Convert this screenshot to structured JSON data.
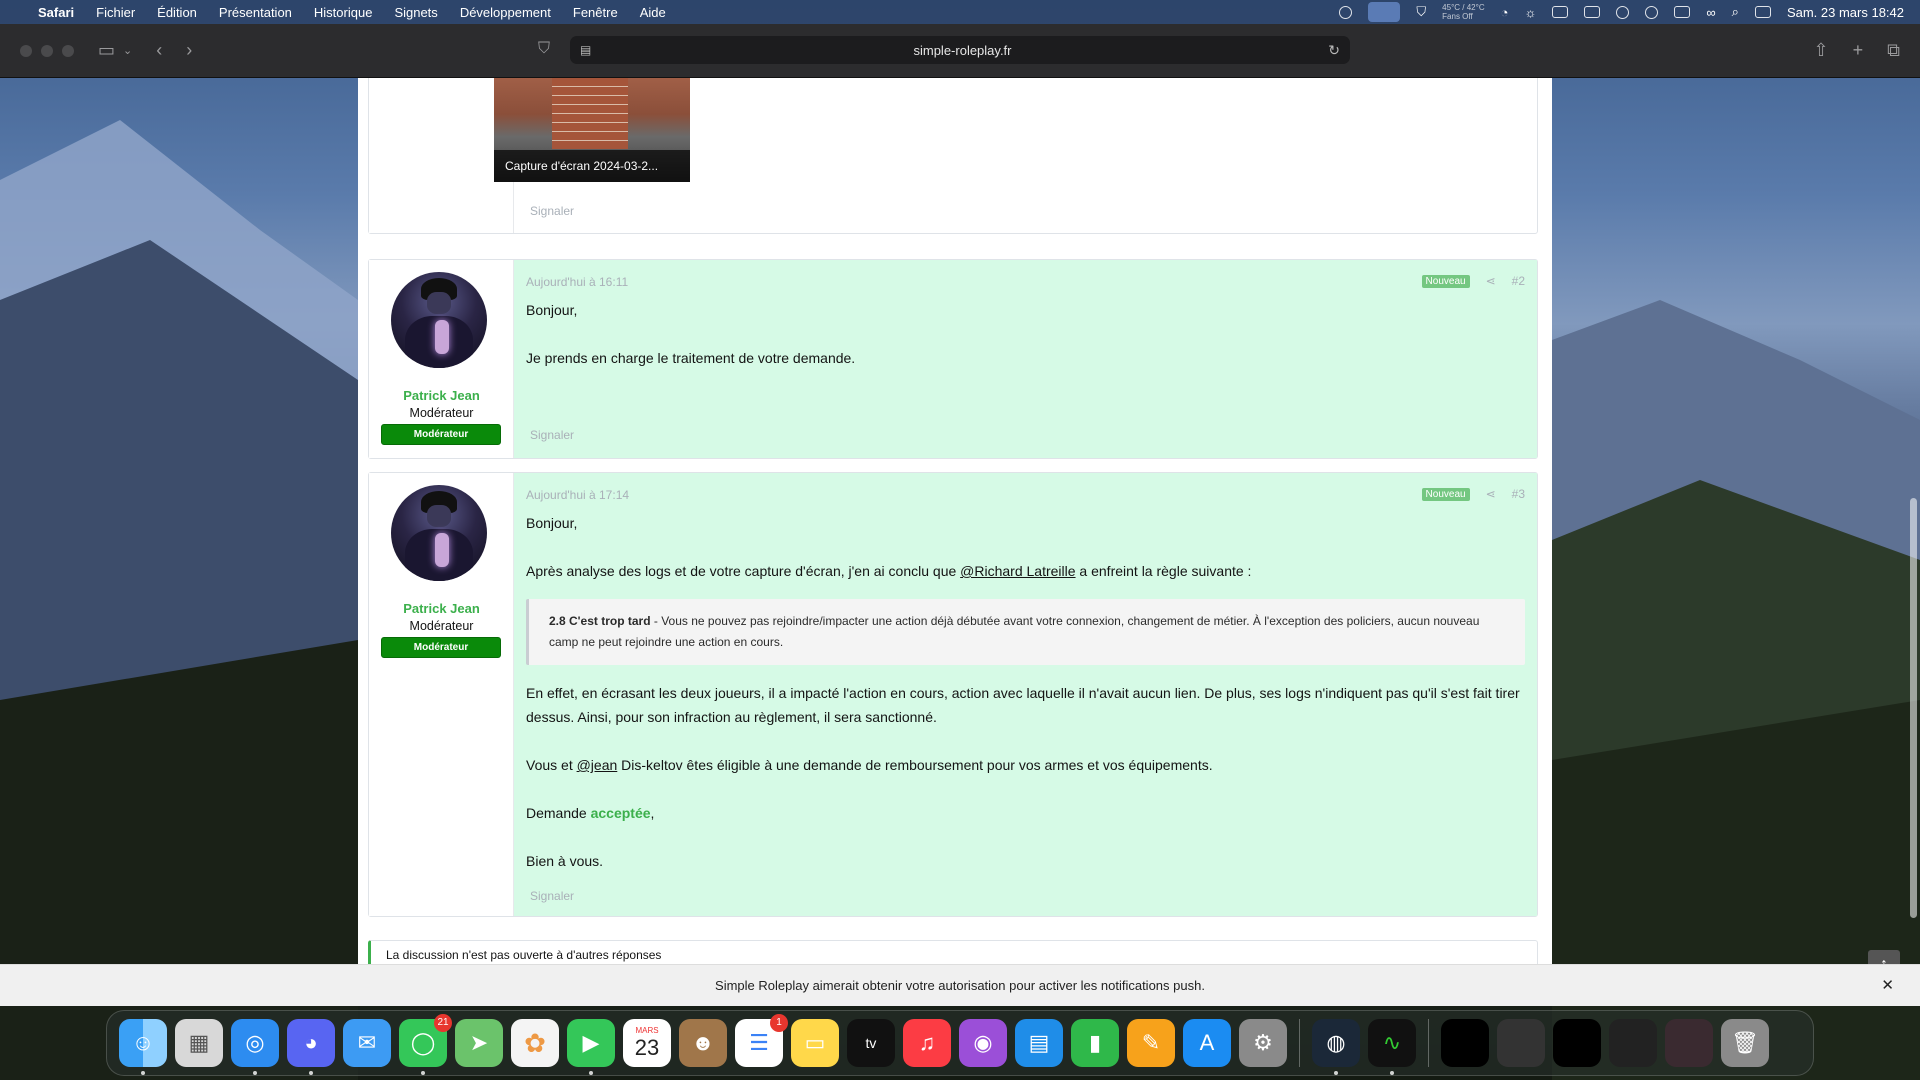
{
  "menubar": {
    "app": "Safari",
    "items": [
      "Fichier",
      "Édition",
      "Présentation",
      "Historique",
      "Signets",
      "Développement",
      "Fenêtre",
      "Aide"
    ],
    "fans": "45°C / 42°C",
    "fans_status": "Fans Off",
    "datetime": "Sam. 23 mars  18:42"
  },
  "toolbar": {
    "url": "simple-roleplay.fr"
  },
  "post1": {
    "attachment_caption": "Capture d'écran 2024-03-2...",
    "report": "Signaler"
  },
  "post2": {
    "date": "Aujourd'hui à 16:11",
    "badge": "Nouveau",
    "number": "#2",
    "username": "Patrick Jean",
    "user_title": "Modérateur",
    "banner": "Modérateur",
    "lines": [
      "Bonjour,",
      "Je prends en charge le traitement de votre demande."
    ],
    "report": "Signaler"
  },
  "post3": {
    "date": "Aujourd'hui à 17:14",
    "badge": "Nouveau",
    "number": "#3",
    "username": "Patrick Jean",
    "user_title": "Modérateur",
    "banner": "Modérateur",
    "greeting": "Bonjour,",
    "analysis_before": "Après analyse des logs et de votre capture d'écran, j'en ai conclu que ",
    "mention1": "@Richard Latreille",
    "analysis_after": " a enfreint la règle suivante :",
    "quote_rule": "2.8 C'est trop tard",
    "quote_text": " - Vous ne pouvez pas rejoindre/impacter une action déjà débutée avant votre connexion, changement de métier. À l'exception des policiers, aucun nouveau camp ne peut rejoindre une action en cours.",
    "paragraph": "En effet, en écrasant les deux joueurs, il a impacté l'action en cours, action avec laquelle il n'avait aucun lien. De plus, ses logs n'indiquent pas qu'il s'est fait tirer dessus. Ainsi, pour son infraction au règlement, il sera sanctionné.",
    "refund_before": "Vous et ",
    "mention2": "@jean",
    "refund_after": " Dis-keltov êtes éligible à une demande de remboursement pour vos armes et vos équipements.",
    "decision_before": "Demande ",
    "decision_word": "acceptée",
    "decision_after": ",",
    "closing": "Bien à vous.",
    "report": "Signaler"
  },
  "closed_notice": "La discussion n'est pas ouverte à d'autres réponses",
  "notification": {
    "text_before": "Simple Roleplay aimerait obtenir votre autorisation pour ",
    "text_link": "activer les notifications push",
    "text_after": "."
  },
  "dock": {
    "messages_badge": "21",
    "reminders_badge": "1",
    "calendar_month": "MARS",
    "calendar_day": "23",
    "tv_label": "tv"
  }
}
